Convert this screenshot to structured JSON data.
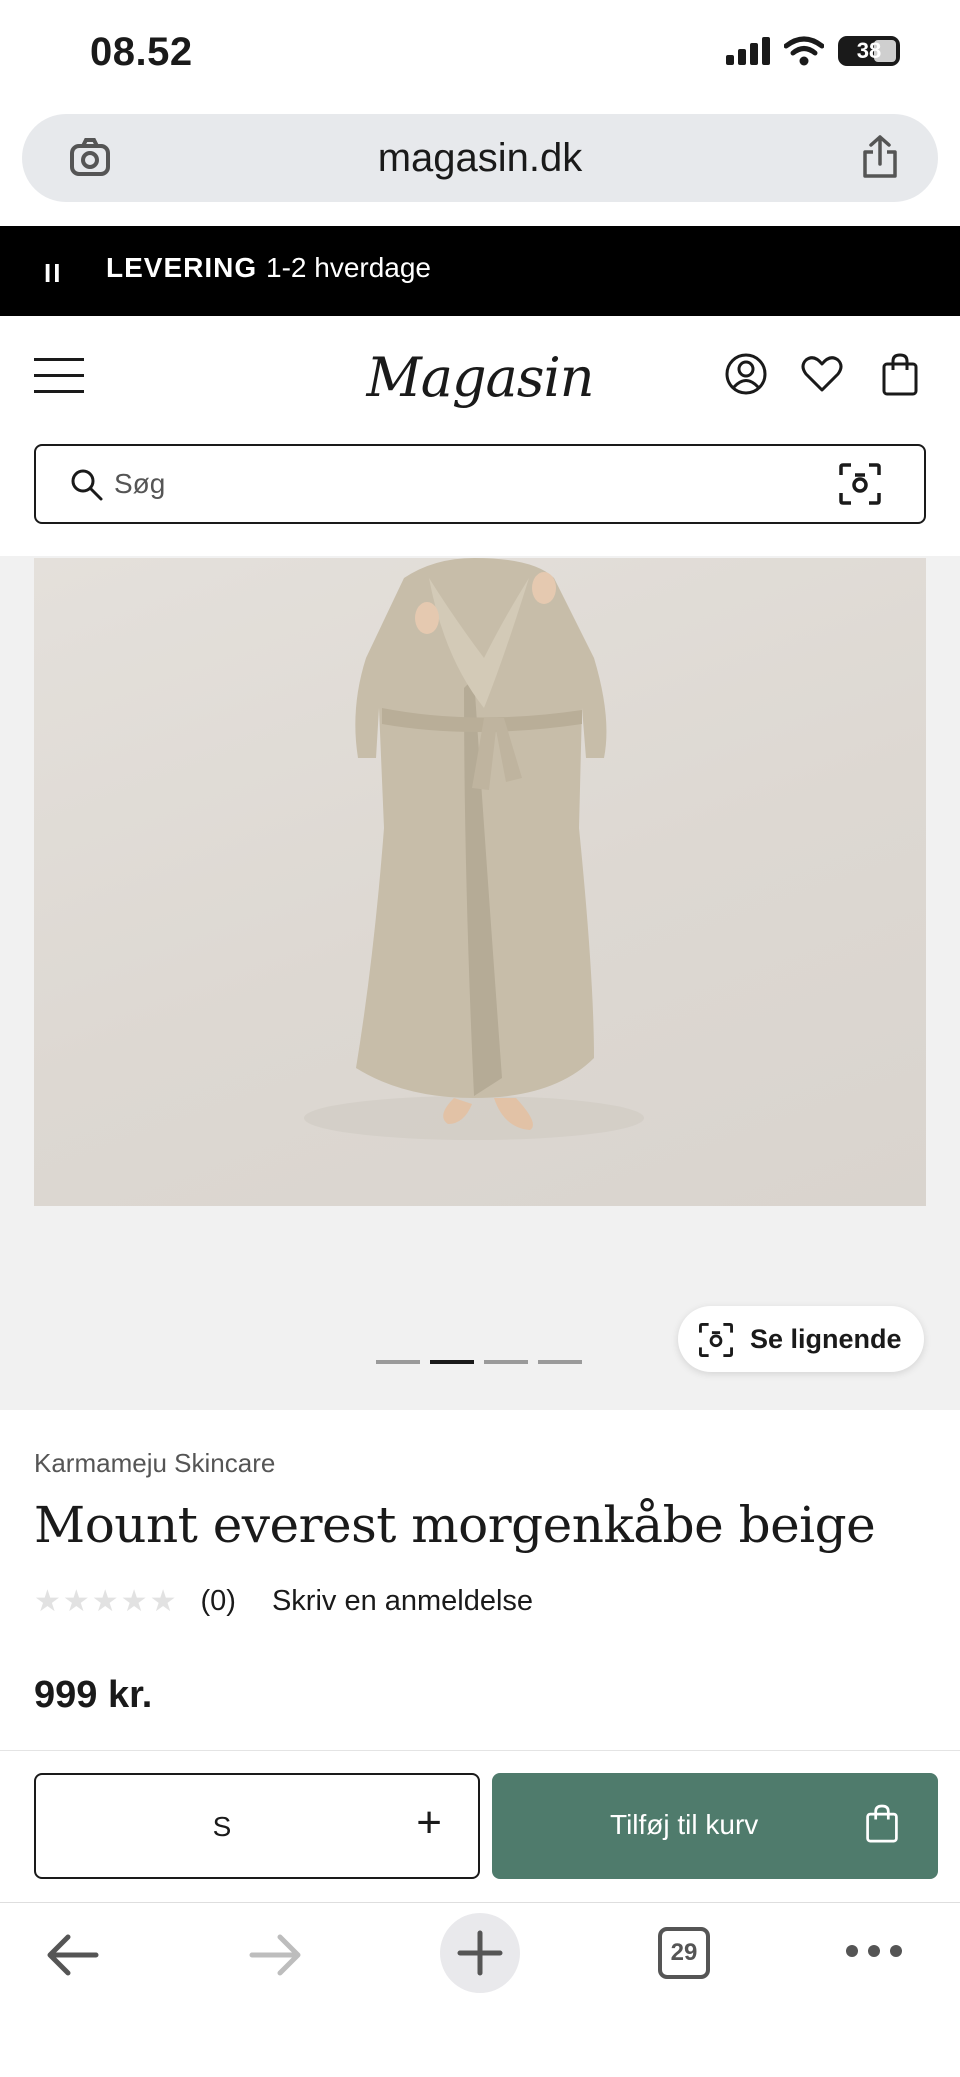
{
  "status_bar": {
    "time": "08.52",
    "battery": "38"
  },
  "browser": {
    "url": "magasin.dk",
    "tabs_count": "29"
  },
  "promo": {
    "label": "LEVERING",
    "text": "1-2 hverdage",
    "pause_symbol": "II"
  },
  "header": {
    "logo": "Magasin",
    "search_placeholder": "Søg"
  },
  "gallery": {
    "similar_label": "Se lignende",
    "image_count": 4,
    "active_index": 1
  },
  "product": {
    "brand": "Karmameju Skincare",
    "title": "Mount everest morgenkåbe beige",
    "stars": "★★★★★",
    "rating_value": 0,
    "review_count": "(0)",
    "review_link": "Skriv en anmeldelse",
    "price": "999 kr."
  },
  "cart": {
    "size": "S",
    "add_label": "Tilføj til kurv",
    "accent_color": "#4f7b6c"
  }
}
